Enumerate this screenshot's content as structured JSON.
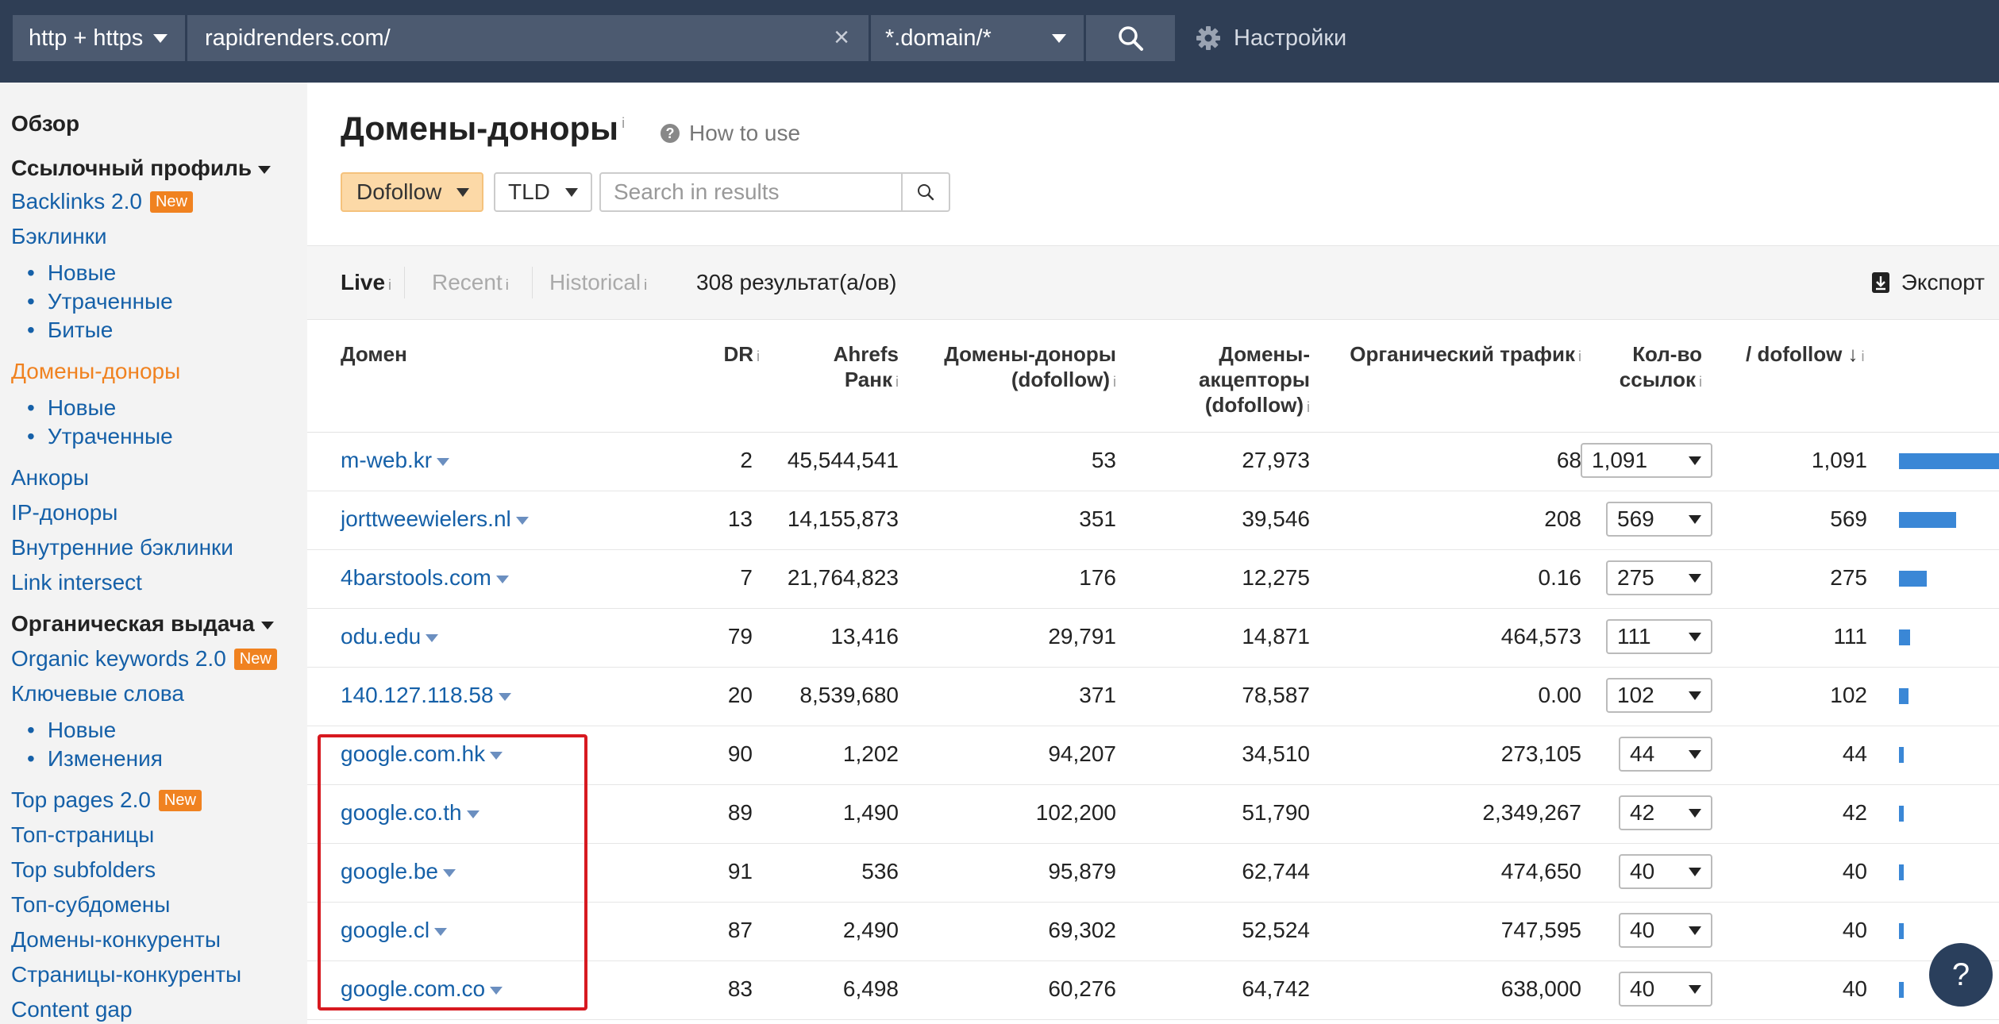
{
  "topbar": {
    "protocol": "http + https",
    "url": "rapidrenders.com/",
    "mode": "*.domain/*",
    "settings": "Настройки"
  },
  "sidebar": {
    "items": [
      {
        "label": "Обзор",
        "kind": "head"
      },
      {
        "label": "Ссылочный профиль",
        "kind": "head-arrow"
      },
      {
        "label": "Backlinks 2.0",
        "kind": "link",
        "badge": "New"
      },
      {
        "label": "Бэклинки",
        "kind": "link"
      },
      {
        "label": "Новые",
        "kind": "sub"
      },
      {
        "label": "Утраченные",
        "kind": "sub"
      },
      {
        "label": "Битые",
        "kind": "sub"
      },
      {
        "label": "Домены-доноры",
        "kind": "active"
      },
      {
        "label": "Новые",
        "kind": "sub"
      },
      {
        "label": "Утраченные",
        "kind": "sub"
      },
      {
        "label": "Анкоры",
        "kind": "link"
      },
      {
        "label": "IP-доноры",
        "kind": "link"
      },
      {
        "label": "Внутренние бэклинки",
        "kind": "link"
      },
      {
        "label": "Link intersect",
        "kind": "link"
      },
      {
        "label": "Органическая выдача",
        "kind": "head-arrow"
      },
      {
        "label": "Organic keywords 2.0",
        "kind": "link",
        "badge": "New"
      },
      {
        "label": "Ключевые слова",
        "kind": "link"
      },
      {
        "label": "Новые",
        "kind": "sub"
      },
      {
        "label": "Изменения",
        "kind": "sub"
      },
      {
        "label": "Top pages 2.0",
        "kind": "link",
        "badge": "New"
      },
      {
        "label": "Топ-страницы",
        "kind": "link"
      },
      {
        "label": "Top subfolders",
        "kind": "link"
      },
      {
        "label": "Топ-субдомены",
        "kind": "link"
      },
      {
        "label": "Домены-конкуренты",
        "kind": "link"
      },
      {
        "label": "Страницы-конкуренты",
        "kind": "link"
      },
      {
        "label": "Content gap",
        "kind": "link"
      }
    ]
  },
  "page": {
    "title": "Домены-доноры",
    "info": "i",
    "how_to_use": "How to use",
    "help_glyph": "?"
  },
  "filters": {
    "dofollow": "Dofollow",
    "tld": "TLD",
    "search_placeholder": "Search in results"
  },
  "tabs": {
    "live": "Live",
    "recent": "Recent",
    "historical": "Historical",
    "results": "308 результат(а/ов)",
    "export": "Экспорт"
  },
  "table": {
    "headers": {
      "domain": "Домен",
      "dr": "DR",
      "rank_1": "Ahrefs",
      "rank_2": "Ранк",
      "ref_1": "Домены-доноры",
      "ref_2": "(dofollow)",
      "linked_1": "Домены-",
      "linked_2": "акцепторы",
      "linked_3": "(dofollow)",
      "traffic": "Органический трафик",
      "links_1": "Кол-во",
      "links_2": "ссылок",
      "dofollow": "/ dofollow"
    },
    "rows": [
      {
        "domain": "m-web.kr",
        "dr": "2",
        "rank": "45,544,541",
        "ref": "53",
        "linked": "27,973",
        "traffic": "68",
        "links": "1,091",
        "dofollow": "1,091",
        "bar": 1.0
      },
      {
        "domain": "jorttweewielers.nl",
        "dr": "13",
        "rank": "14,155,873",
        "ref": "351",
        "linked": "39,546",
        "traffic": "208",
        "links": "569",
        "dofollow": "569",
        "bar": 0.52
      },
      {
        "domain": "4barstools.com",
        "dr": "7",
        "rank": "21,764,823",
        "ref": "176",
        "linked": "12,275",
        "traffic": "0.16",
        "links": "275",
        "dofollow": "275",
        "bar": 0.25
      },
      {
        "domain": "odu.edu",
        "dr": "79",
        "rank": "13,416",
        "ref": "29,791",
        "linked": "14,871",
        "traffic": "464,573",
        "links": "111",
        "dofollow": "111",
        "bar": 0.1
      },
      {
        "domain": "140.127.118.58",
        "dr": "20",
        "rank": "8,539,680",
        "ref": "371",
        "linked": "78,587",
        "traffic": "0.00",
        "links": "102",
        "dofollow": "102",
        "bar": 0.09
      },
      {
        "domain": "google.com.hk",
        "dr": "90",
        "rank": "1,202",
        "ref": "94,207",
        "linked": "34,510",
        "traffic": "273,105",
        "links": "44",
        "dofollow": "44",
        "bar": 0.04
      },
      {
        "domain": "google.co.th",
        "dr": "89",
        "rank": "1,490",
        "ref": "102,200",
        "linked": "51,790",
        "traffic": "2,349,267",
        "links": "42",
        "dofollow": "42",
        "bar": 0.04
      },
      {
        "domain": "google.be",
        "dr": "91",
        "rank": "536",
        "ref": "95,879",
        "linked": "62,744",
        "traffic": "474,650",
        "links": "40",
        "dofollow": "40",
        "bar": 0.037
      },
      {
        "domain": "google.cl",
        "dr": "87",
        "rank": "2,490",
        "ref": "69,302",
        "linked": "52,524",
        "traffic": "747,595",
        "links": "40",
        "dofollow": "40",
        "bar": 0.037
      },
      {
        "domain": "google.com.co",
        "dr": "83",
        "rank": "6,498",
        "ref": "60,276",
        "linked": "64,742",
        "traffic": "638,000",
        "links": "40",
        "dofollow": "40",
        "bar": 0.037
      }
    ]
  },
  "colors": {
    "topbar": "#2f3e55",
    "link": "#1560a8",
    "active": "#f08220",
    "bar": "#3a87d6",
    "highlight": "#d71920"
  }
}
